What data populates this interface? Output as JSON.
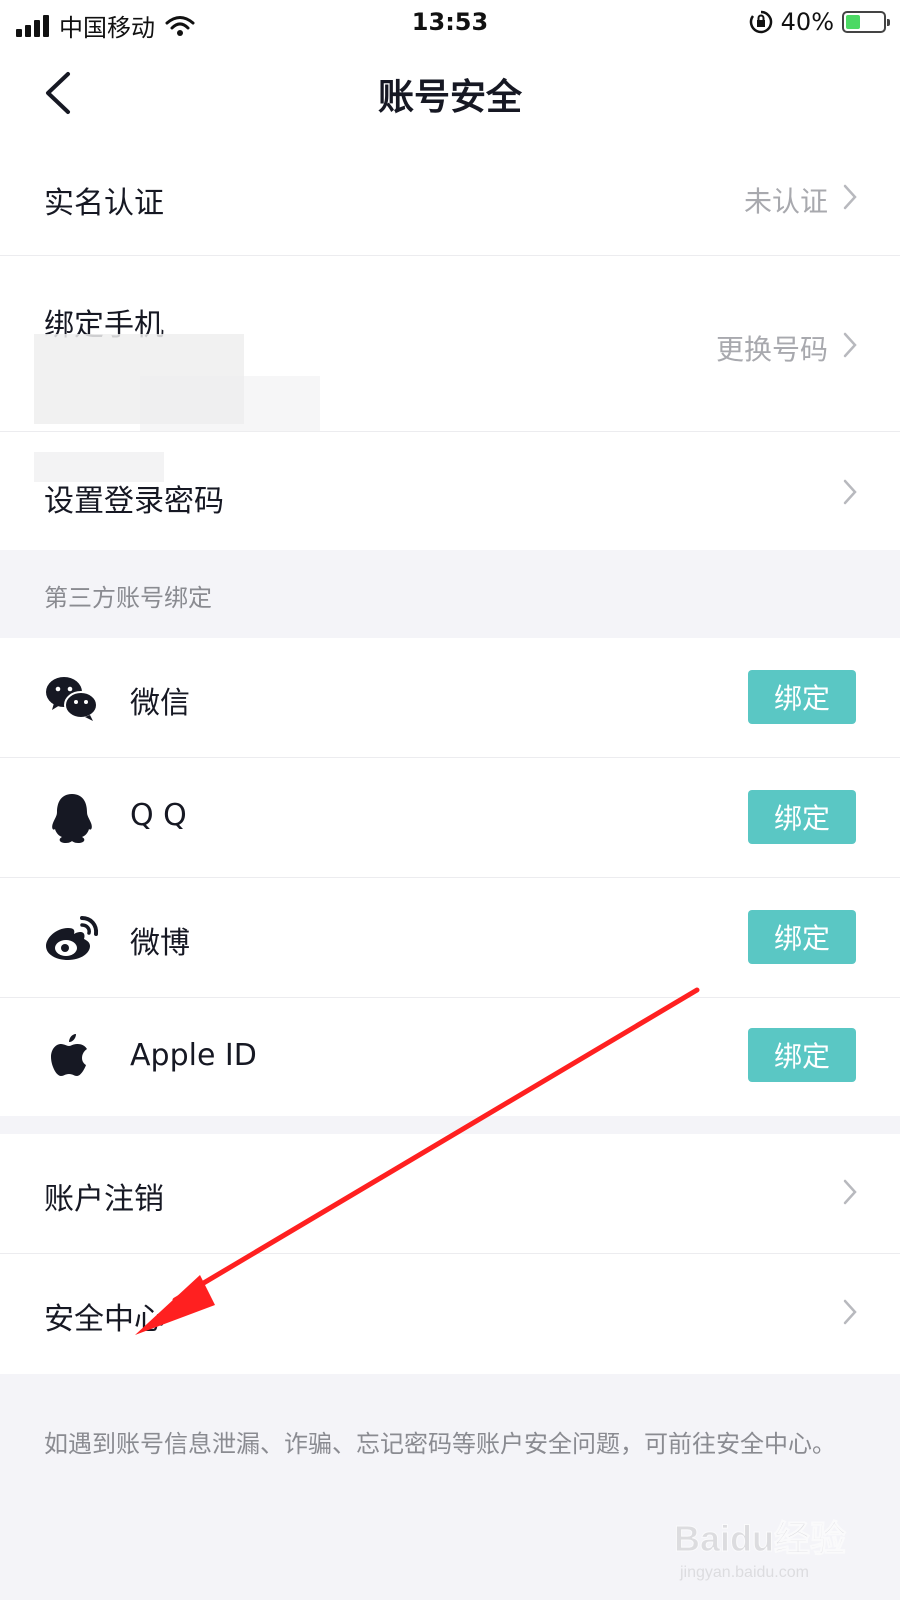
{
  "status_bar": {
    "carrier": "中国移动",
    "time": "13:53",
    "battery_percent": "40%",
    "battery_level": 0.4,
    "icons": [
      "signal-icon",
      "wifi-icon",
      "orientation-lock-icon",
      "battery-charging-icon"
    ]
  },
  "header": {
    "title": "账号安全",
    "back_icon": "chevron-left-icon"
  },
  "rows": {
    "real_name": {
      "label": "实名认证",
      "value": "未认证"
    },
    "bind_phone": {
      "label": "绑定手机",
      "value": "更换号码"
    },
    "set_password": {
      "label": "设置登录密码"
    },
    "cancel_account": {
      "label": "账户注销"
    },
    "security_center": {
      "label": "安全中心"
    }
  },
  "third_party": {
    "header": "第三方账号绑定",
    "items": [
      {
        "name": "微信",
        "icon": "wechat-icon",
        "button": "绑定"
      },
      {
        "name": "Q Q",
        "icon": "qq-icon",
        "button": "绑定"
      },
      {
        "name": "微博",
        "icon": "weibo-icon",
        "button": "绑定"
      },
      {
        "name": "Apple ID",
        "icon": "apple-icon",
        "button": "绑定"
      }
    ]
  },
  "footnote": "如遇到账号信息泄漏、诈骗、忘记密码等账户安全问题，可前往安全中心。",
  "watermark": {
    "brand": "Baidu经验",
    "url": "jingyan.baidu.com"
  },
  "colors": {
    "accent": "#5ac7c4",
    "background": "#f4f4f8",
    "annotation_arrow": "#ff2020"
  }
}
